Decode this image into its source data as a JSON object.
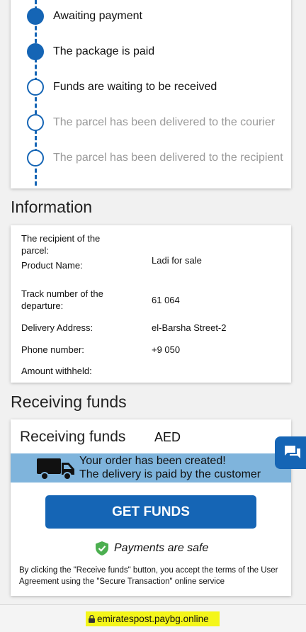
{
  "timeline": {
    "steps": [
      {
        "label": "Awaiting payment",
        "state": "done"
      },
      {
        "label": "The package is paid",
        "state": "done"
      },
      {
        "label": "Funds are waiting to be received",
        "state": "pending"
      },
      {
        "label": "The parcel has been delivered to the courier",
        "state": "upcoming"
      },
      {
        "label": "The parcel has been delivered to the recipient",
        "state": "upcoming"
      }
    ]
  },
  "information": {
    "heading": "Information",
    "rows": [
      {
        "label": "The recipient of the parcel:",
        "value": ""
      },
      {
        "label": "Product Name:",
        "value": "Ladi                                     for sale"
      },
      {
        "label": "Track number of the departure:",
        "value": "61              064"
      },
      {
        "label": "Delivery Address:",
        "value": "el-Barsha Street-2"
      },
      {
        "label": "Phone number:",
        "value": "+9              050"
      },
      {
        "label": "Amount withheld:",
        "value": ""
      }
    ]
  },
  "receiving": {
    "heading": "Receiving funds",
    "card_title": "Receiving funds",
    "currency": "AED",
    "banner_line1": "Your order has been created!",
    "banner_line2": "The delivery is paid by the customer",
    "button_label": "GET FUNDS",
    "safe_text": "Payments are safe",
    "terms": "By clicking the \"Receive funds\" button, you accept the terms of the User Agreement using the \"Secure Transaction\" online service"
  },
  "browser": {
    "url": "emiratespost.paybg.online"
  },
  "colors": {
    "accent": "#1565b5",
    "banner": "#7fb4dc",
    "url_highlight": "#f4f61a",
    "safe_green": "#4caf50"
  },
  "icons": [
    "truck-icon",
    "shield-check-icon",
    "chat-icon",
    "lock-icon"
  ]
}
